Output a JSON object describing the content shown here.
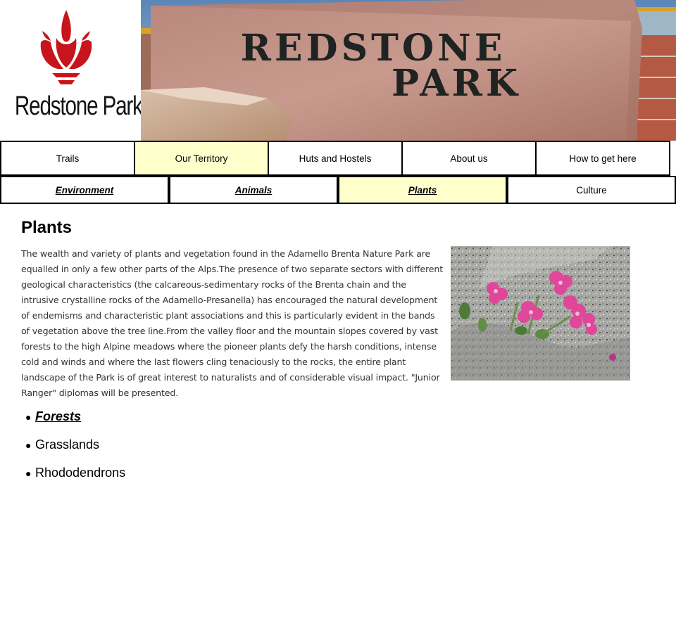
{
  "header": {
    "logo_text": "Redstone Park",
    "banner_text_line1": "REDSTONE",
    "banner_text_line2": "PARK"
  },
  "nav_primary": [
    {
      "label": "Trails",
      "active": false
    },
    {
      "label": "Our Territory",
      "active": true
    },
    {
      "label": "Huts and Hostels",
      "active": false
    },
    {
      "label": "About us",
      "active": false
    },
    {
      "label": "How to get here",
      "active": false
    }
  ],
  "nav_secondary": [
    {
      "label": "Environment",
      "active": false
    },
    {
      "label": "Animals",
      "active": false
    },
    {
      "label": "Plants",
      "active": true
    },
    {
      "label": "Culture",
      "active": false
    }
  ],
  "main": {
    "title": "Plants",
    "intro": "The wealth and variety of plants and vegetation found in the Adamello Brenta Nature Park are equalled in only a few other parts of the Alps.The presence of two separate sectors with different geological characteristics (the calcareous-sedimentary rocks of the Brenta chain and the intrusive crystalline rocks of the Adamello-Presanella) has encouraged the natural development of endemisms and characteristic plant associations and this is particularly evident in the bands of vegetation above the tree line.From the valley floor and the mountain slopes covered by vast forests to the high Alpine meadows where the pioneer plants defy the harsh conditions, intense cold and winds and where the last flowers cling tenaciously to the rocks, the entire plant landscape of the Park is of great interest to naturalists and of considerable visual impact. \"Junior Ranger\" diplomas will be presented.",
    "topics": [
      {
        "label": "Forests",
        "link": true
      },
      {
        "label": "Grasslands",
        "link": false
      },
      {
        "label": "Rhododendrons",
        "link": false
      }
    ]
  },
  "colors": {
    "active_tab": "#ffffcc",
    "logo_red": "#c8141c"
  }
}
